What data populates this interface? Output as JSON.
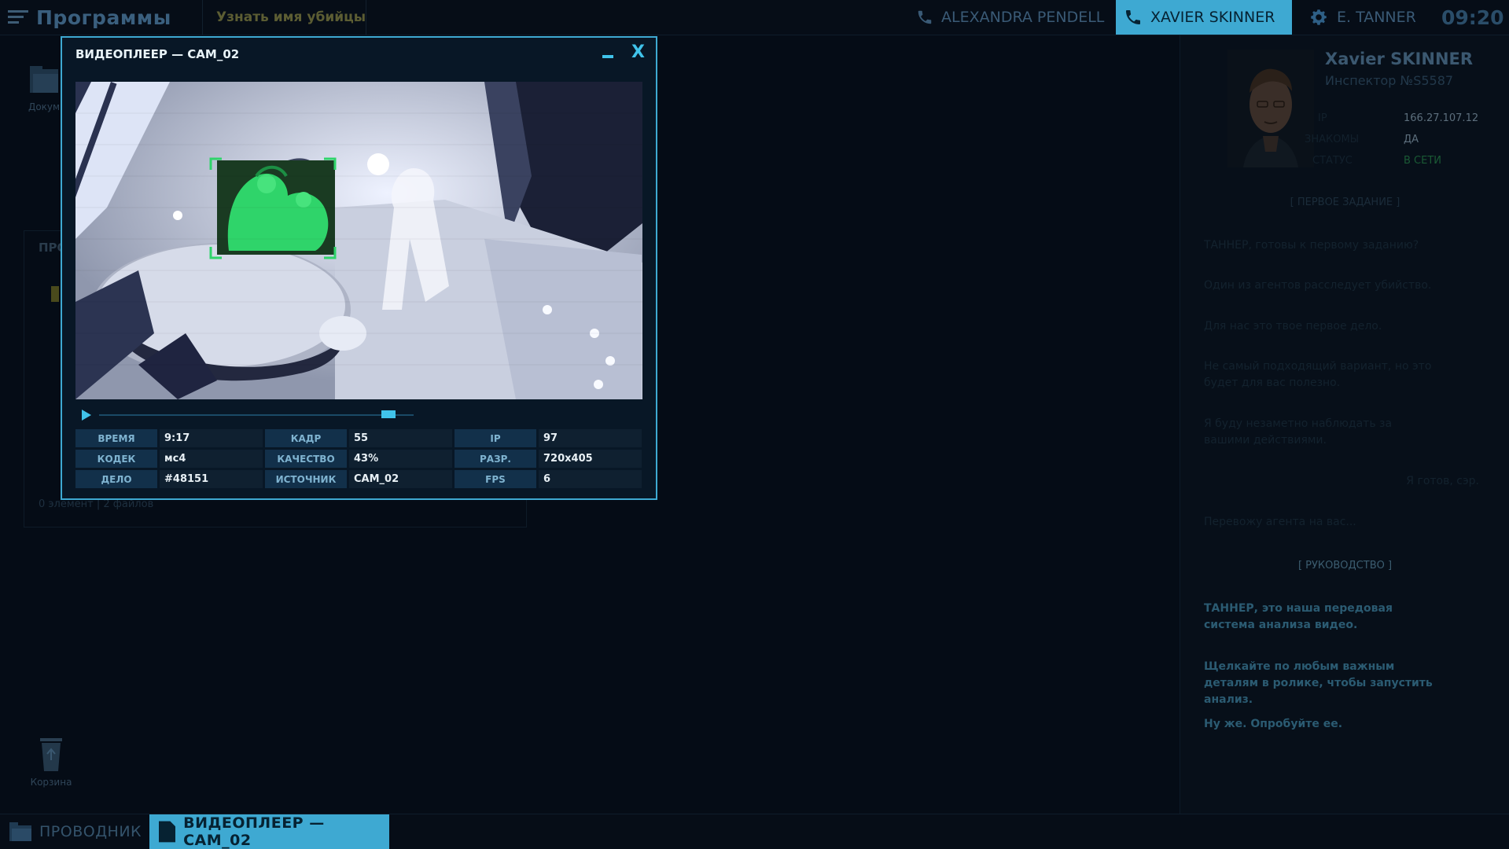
{
  "topbar": {
    "menu_icon": "hamburger-icon",
    "programs_title": "Программы",
    "task_label": "Узнать имя убийцы",
    "contacts": [
      {
        "name": "ALEXANDRA PENDELL",
        "icon": "phone-icon",
        "active": false
      },
      {
        "name": "XAVIER SKINNER",
        "icon": "phone-icon",
        "active": true
      },
      {
        "name": "E. TANNER",
        "icon": "gear-icon",
        "active": false
      }
    ],
    "clock": "09:20"
  },
  "desktop": {
    "icons": [
      {
        "label": "Докум",
        "icon": "folder-icon"
      },
      {
        "label": "Корзина",
        "icon": "recycle-bin-icon"
      }
    ],
    "panel_title": "ПРО",
    "panel_status": "0 элемент  |  2 файлов"
  },
  "player": {
    "title": "ВИДЕОПЛЕЕР — CAM_02",
    "playback_position": 0.92,
    "info": [
      {
        "key": "ВРЕМЯ",
        "value": "9:17"
      },
      {
        "key": "КАДР",
        "value": "55"
      },
      {
        "key": "IP",
        "value": "97"
      },
      {
        "key": "КОДЕК",
        "value": "мс4"
      },
      {
        "key": "КАЧЕСТВО",
        "value": "43%"
      },
      {
        "key": "РАЗР.",
        "value": "720x405"
      },
      {
        "key": "ДЕЛО",
        "value": "#48151"
      },
      {
        "key": "ИСТОЧНИК",
        "value": "CAM_02"
      },
      {
        "key": "FPS",
        "value": "6"
      }
    ]
  },
  "right_panel": {
    "name": "Xavier SKINNER",
    "rank": "Инспектор №S5587",
    "fields": [
      {
        "key": "IP",
        "value": "166.27.107.12"
      },
      {
        "key": "ЗНАКОМЫ",
        "value": "ДА"
      },
      {
        "key": "СТАТУС",
        "value": "В СЕТИ"
      }
    ],
    "section1": "[   ПЕРВОЕ ЗАДАНИЕ   ]",
    "messages1": [
      "ТАННЕР, готовы к первому заданию?",
      "Один из агентов расследует убийство.",
      "Для нас это твое первое дело.",
      "Не самый подходящий вариант, но это будет для вас полезно.",
      "Я буду незаметно наблюдать за вашими действиями."
    ],
    "reply": "Я готов, сэр.",
    "message_after": "Перевожу агента на вас...",
    "section2": "[   РУКОВОДСТВО   ]",
    "messages2": [
      "ТАННЕР, это наша передовая система анализа видео.",
      "Щелкайте по любым важным деталям в ролике, чтобы запустить анализ.",
      "Ну же. Опробуйте ее."
    ]
  },
  "taskbar": {
    "explorer": "ПРОВОДНИК",
    "player": "ВИДЕОПЛЕЕР — CAM_02"
  },
  "colors": {
    "accent": "#3ea9d2",
    "highlight_green": "#2fd46a"
  }
}
